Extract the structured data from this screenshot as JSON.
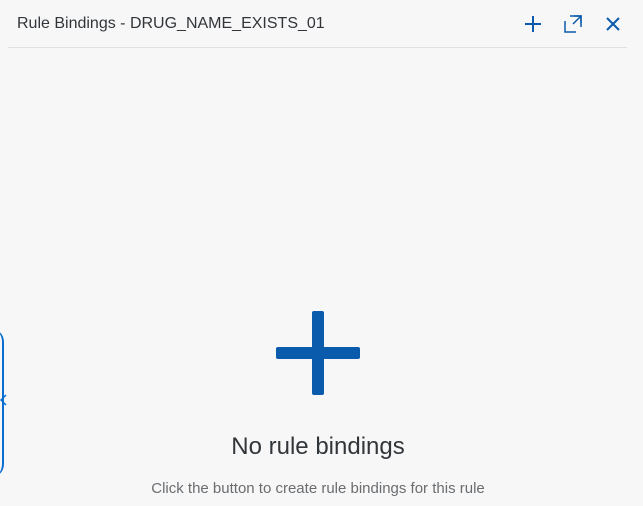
{
  "header": {
    "title": "Rule Bindings - DRUG_NAME_EXISTS_01",
    "actions": [
      {
        "icon": "add-icon"
      },
      {
        "icon": "full-screen-icon"
      },
      {
        "icon": "close-icon"
      }
    ]
  },
  "empty_state": {
    "icon": "add-icon",
    "title": "No rule bindings",
    "description": "Click the button to create rule bindings for this rule"
  },
  "colors": {
    "accent": "#0a5bab",
    "background": "#f7f7f7",
    "text": "#32363a",
    "muted_text": "#6a6d70"
  }
}
